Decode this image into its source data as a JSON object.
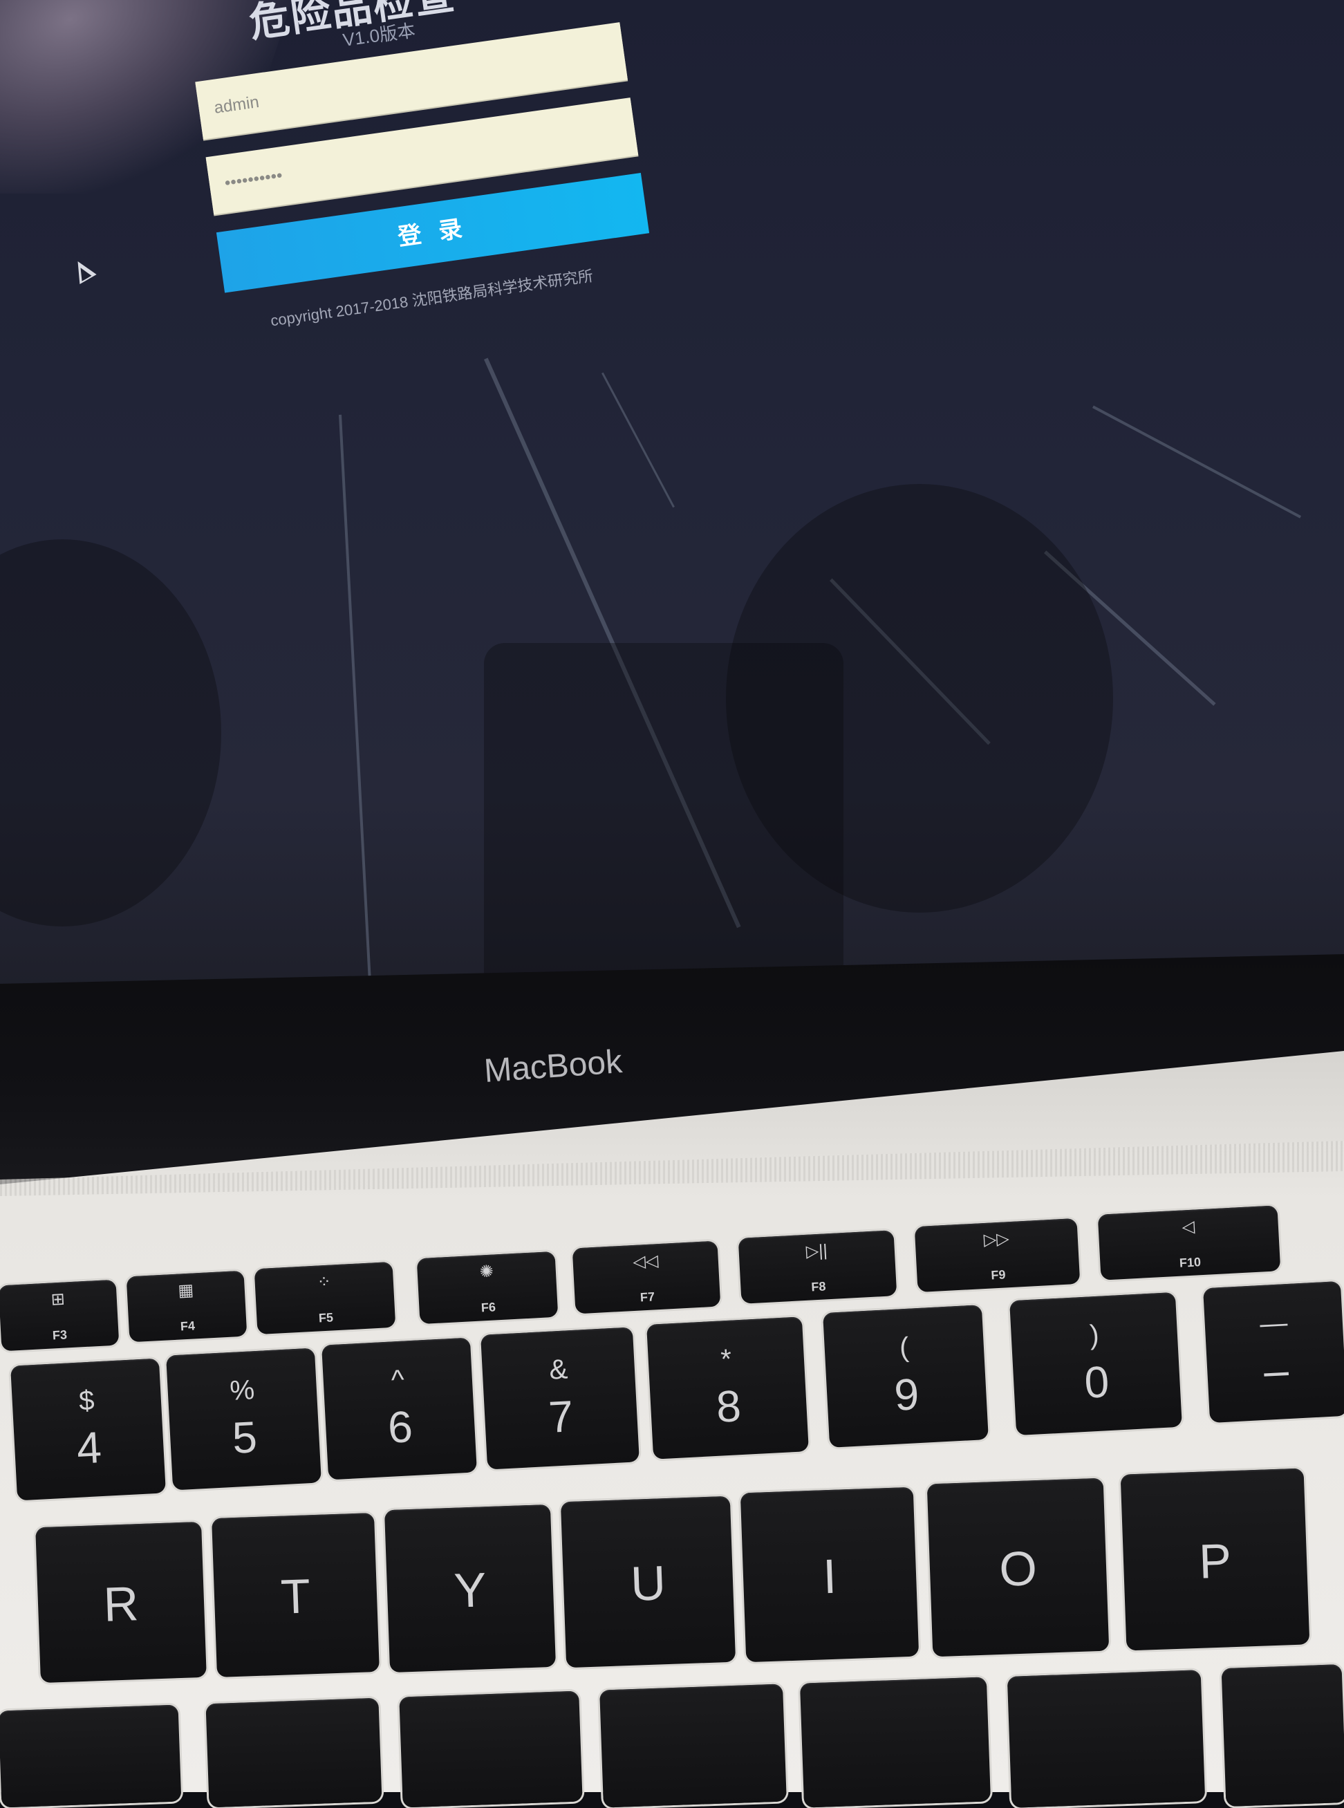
{
  "login": {
    "title": "危险品检查",
    "version": "V1.0版本",
    "username_value": "admin",
    "password_value": "••••••••••",
    "button_label": "登 录",
    "copyright": "copyright 2017-2018 沈阳铁路局科学技术研究所"
  },
  "laptop": {
    "brand": "MacBook"
  },
  "keyboard": {
    "fn_keys": [
      {
        "symbol": "⊞",
        "label": "F3"
      },
      {
        "symbol": "▦",
        "label": "F4"
      },
      {
        "symbol": "⁘",
        "label": "F5"
      },
      {
        "symbol": "✺",
        "label": "F6"
      },
      {
        "symbol": "◁◁",
        "label": "F7"
      },
      {
        "symbol": "▷||",
        "label": "F8"
      },
      {
        "symbol": "▷▷",
        "label": "F9"
      },
      {
        "symbol": "◁",
        "label": "F10"
      }
    ],
    "number_keys": [
      {
        "top": "$",
        "main": "4"
      },
      {
        "top": "%",
        "main": "5"
      },
      {
        "top": "^",
        "main": "6"
      },
      {
        "top": "&",
        "main": "7"
      },
      {
        "top": "*",
        "main": "8"
      },
      {
        "top": "(",
        "main": "9"
      },
      {
        "top": ")",
        "main": "0"
      },
      {
        "top": "—",
        "main": "–"
      }
    ],
    "letter_keys": [
      "R",
      "T",
      "Y",
      "U",
      "I",
      "O",
      "P"
    ]
  }
}
